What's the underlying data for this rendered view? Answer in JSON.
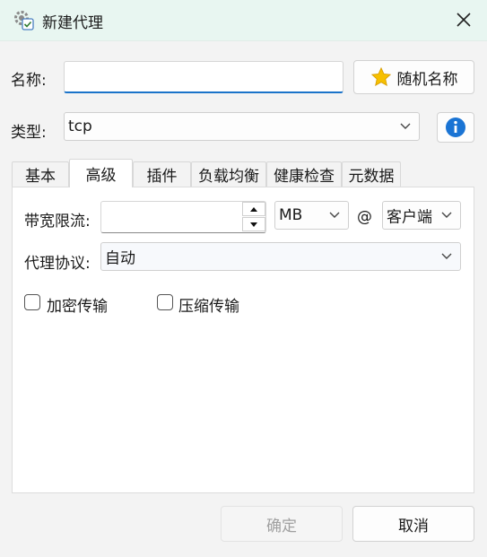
{
  "window": {
    "title": "新建代理"
  },
  "form": {
    "name_label": "名称:",
    "name_value": "",
    "random_name_label": "随机名称",
    "type_label": "类型:",
    "type_value": "tcp"
  },
  "tabs": [
    {
      "label": "基本",
      "active": false
    },
    {
      "label": "高级",
      "active": true
    },
    {
      "label": "插件",
      "active": false
    },
    {
      "label": "负载均衡",
      "active": false
    },
    {
      "label": "健康检查",
      "active": false
    },
    {
      "label": "元数据",
      "active": false
    }
  ],
  "advanced": {
    "bandwidth_label": "带宽限流:",
    "bandwidth_value": "",
    "unit_value": "MB",
    "at_symbol": "@",
    "side_value": "客户端",
    "protocol_label": "代理协议:",
    "protocol_value": "自动",
    "encrypt_label": "加密传输",
    "encrypt_checked": false,
    "compress_label": "压缩传输",
    "compress_checked": false
  },
  "footer": {
    "ok_label": "确定",
    "cancel_label": "取消"
  },
  "colors": {
    "titlebar": "#e8f6f1",
    "accent": "#1a73c9",
    "info_icon": "#1a74d4",
    "star_icon": "#f7c000"
  },
  "icons": {
    "app": "gear-check-icon",
    "close": "close-icon",
    "star": "star-icon",
    "info": "info-icon"
  }
}
